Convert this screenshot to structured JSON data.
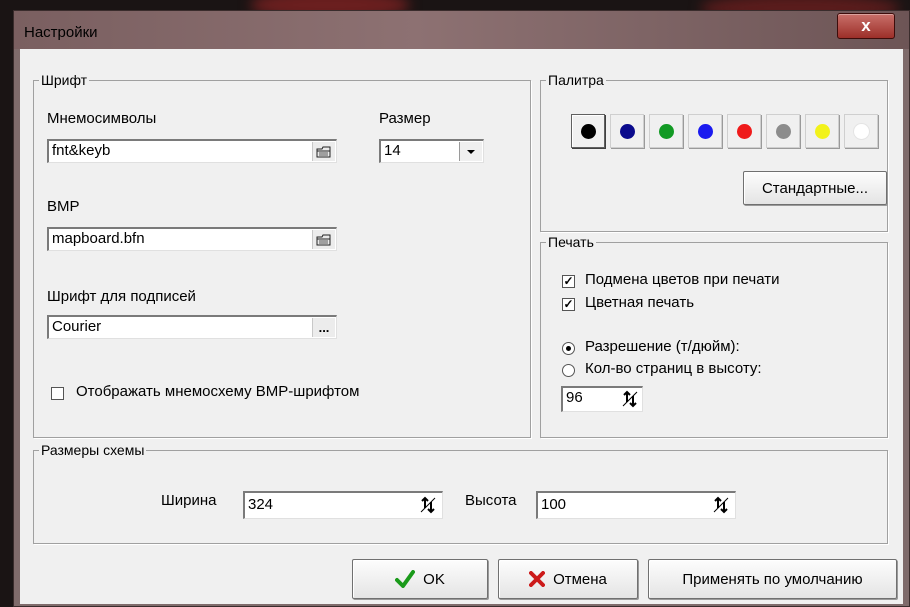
{
  "window": {
    "title": "Настройки",
    "close_glyph": "x"
  },
  "font_group": {
    "legend": "Шрифт",
    "mnemo_label": "Мнемосимволы",
    "mnemo_value": "fnt&keyb",
    "size_label": "Размер",
    "size_value": "14",
    "bmp_label": "BMP",
    "bmp_value": "mapboard.bfn",
    "captions_label": "Шрифт для подписей",
    "captions_value": "Courier",
    "captions_button": "...",
    "bmp_checkbox_label": "Отображать мнемосхему BMP-шрифтом",
    "bmp_checkbox_checked": false
  },
  "palette_group": {
    "legend": "Палитра",
    "colors": [
      {
        "name": "black",
        "hex": "#000000"
      },
      {
        "name": "navy",
        "hex": "#0a0a8c"
      },
      {
        "name": "green",
        "hex": "#129a24"
      },
      {
        "name": "blue",
        "hex": "#1a1aef"
      },
      {
        "name": "red",
        "hex": "#ef1a1a"
      },
      {
        "name": "gray",
        "hex": "#8c8c8c"
      },
      {
        "name": "yellow",
        "hex": "#f2f21a"
      },
      {
        "name": "white",
        "hex": "#ffffff"
      }
    ],
    "selected_index": 0,
    "standard_button": "Стандартные..."
  },
  "print_group": {
    "legend": "Печать",
    "replace_colors_label": "Подмена цветов при печати",
    "replace_colors_checked": true,
    "color_print_label": "Цветная печать",
    "color_print_checked": true,
    "resolution_label": "Разрешение (т/дюйм):",
    "pages_label": "Кол-во страниц в высоту:",
    "selected_option": "resolution",
    "value": "96"
  },
  "size_group": {
    "legend": "Размеры схемы",
    "width_label": "Ширина",
    "width_value": "324",
    "height_label": "Высота",
    "height_value": "100"
  },
  "buttons": {
    "ok_label": "OK",
    "cancel_label": "Отмена",
    "defaults_label": "Применять по умолчанию",
    "ok_icon_color": "#1a9a1a",
    "cancel_icon_color": "#cc1a1a"
  }
}
